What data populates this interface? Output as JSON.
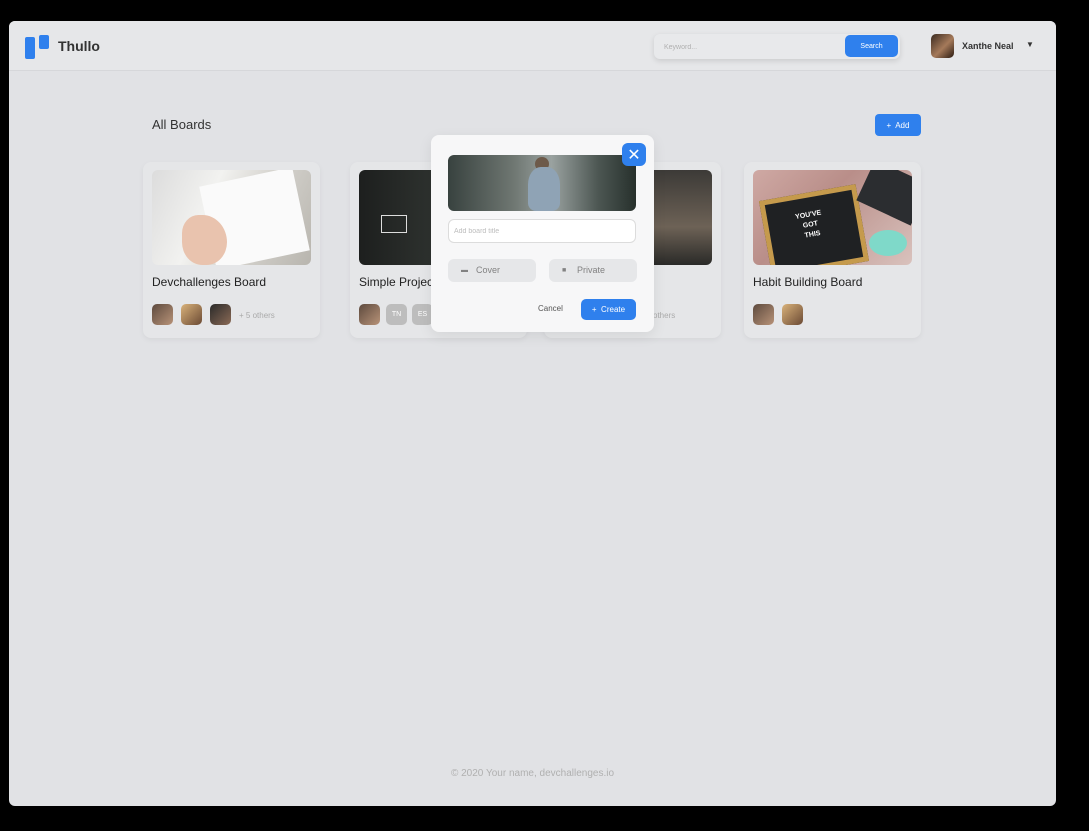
{
  "app": {
    "title": "Thullo"
  },
  "header": {
    "search_placeholder": "Keyword...",
    "search_button": "Search",
    "user_name": "Xanthe Neal",
    "caret_icon": "caret-down-icon"
  },
  "boards": {
    "heading": "All Boards",
    "add_button_icon": "+",
    "add_button_label": "Add",
    "items": [
      {
        "title": "Devchallenges Board",
        "members": [
          "avatar",
          "avatar",
          "avatar"
        ],
        "others": "+ 5 others"
      },
      {
        "title": "Simple Project",
        "initials": [
          "TN",
          "ES"
        ]
      },
      {
        "others": "others"
      },
      {
        "title": "Habit Building Board",
        "members": [
          "avatar",
          "avatar"
        ]
      }
    ],
    "habit_sign": [
      "YOU'VE",
      "GOT",
      "THIS"
    ]
  },
  "modal": {
    "title_placeholder": "Add board title",
    "cover_label": "Cover",
    "private_label": "Private",
    "cancel_label": "Cancel",
    "create_icon": "+",
    "create_label": "Create",
    "close_icon": "close-icon"
  },
  "footer": {
    "copyright": "© 2020 Your name, devchallenges.io"
  },
  "colors": {
    "accent": "#2f80ed",
    "background": "#e1e2e5"
  }
}
